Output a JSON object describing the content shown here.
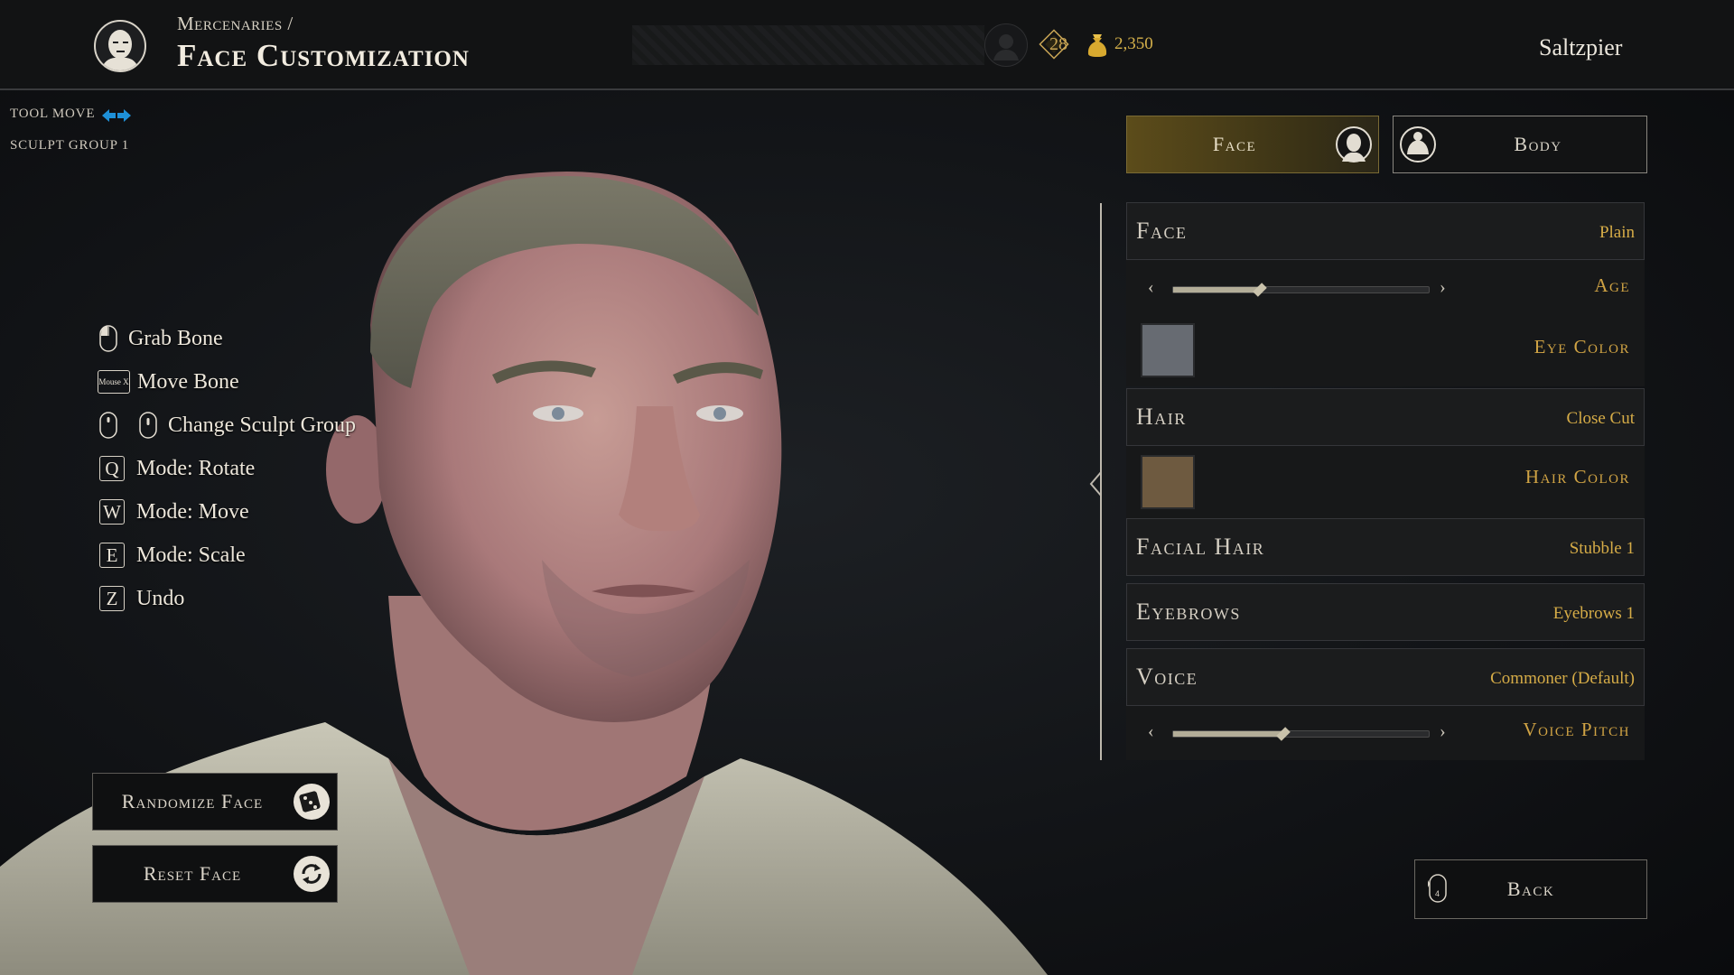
{
  "header": {
    "breadcrumb": "Mercenaries /",
    "title": "Face Customization",
    "level": "28",
    "gold": "2,350",
    "username": "Saltzpier"
  },
  "tool": {
    "mode_label": "TOOL MOVE",
    "sculpt_group": "SCULPT GROUP 1"
  },
  "controls": [
    {
      "key": "mouse-left",
      "label": "Grab Bone"
    },
    {
      "key": "Mouse X",
      "label": "Move Bone"
    },
    {
      "key": "mouse-both",
      "label": "Change Sculpt Group"
    },
    {
      "key": "Q",
      "label": "Mode: Rotate"
    },
    {
      "key": "W",
      "label": "Mode: Move"
    },
    {
      "key": "E",
      "label": "Mode: Scale"
    },
    {
      "key": "Z",
      "label": "Undo"
    }
  ],
  "actions": {
    "randomize": "Randomize Face",
    "reset": "Reset Face"
  },
  "tabs": {
    "face": "Face",
    "body": "Body"
  },
  "panel": {
    "face": {
      "label": "Face",
      "value": "Plain"
    },
    "age": {
      "label": "Age",
      "value": 0.34
    },
    "eye_color": {
      "label": "Eye Color",
      "color": "#676b72"
    },
    "hair": {
      "label": "Hair",
      "value": "Close Cut"
    },
    "hair_color": {
      "label": "Hair Color",
      "color": "#6e5a40"
    },
    "facial_hair": {
      "label": "Facial Hair",
      "value": "Stubble 1"
    },
    "eyebrows": {
      "label": "Eyebrows",
      "value": "Eyebrows 1"
    },
    "voice": {
      "label": "Voice",
      "value": "Commoner (Default)"
    },
    "voice_pitch": {
      "label": "Voice Pitch",
      "value": 0.43
    }
  },
  "back": "Back",
  "colors": {
    "accent_gold": "#d6ac47",
    "active_tab": "#5c4c1a"
  }
}
